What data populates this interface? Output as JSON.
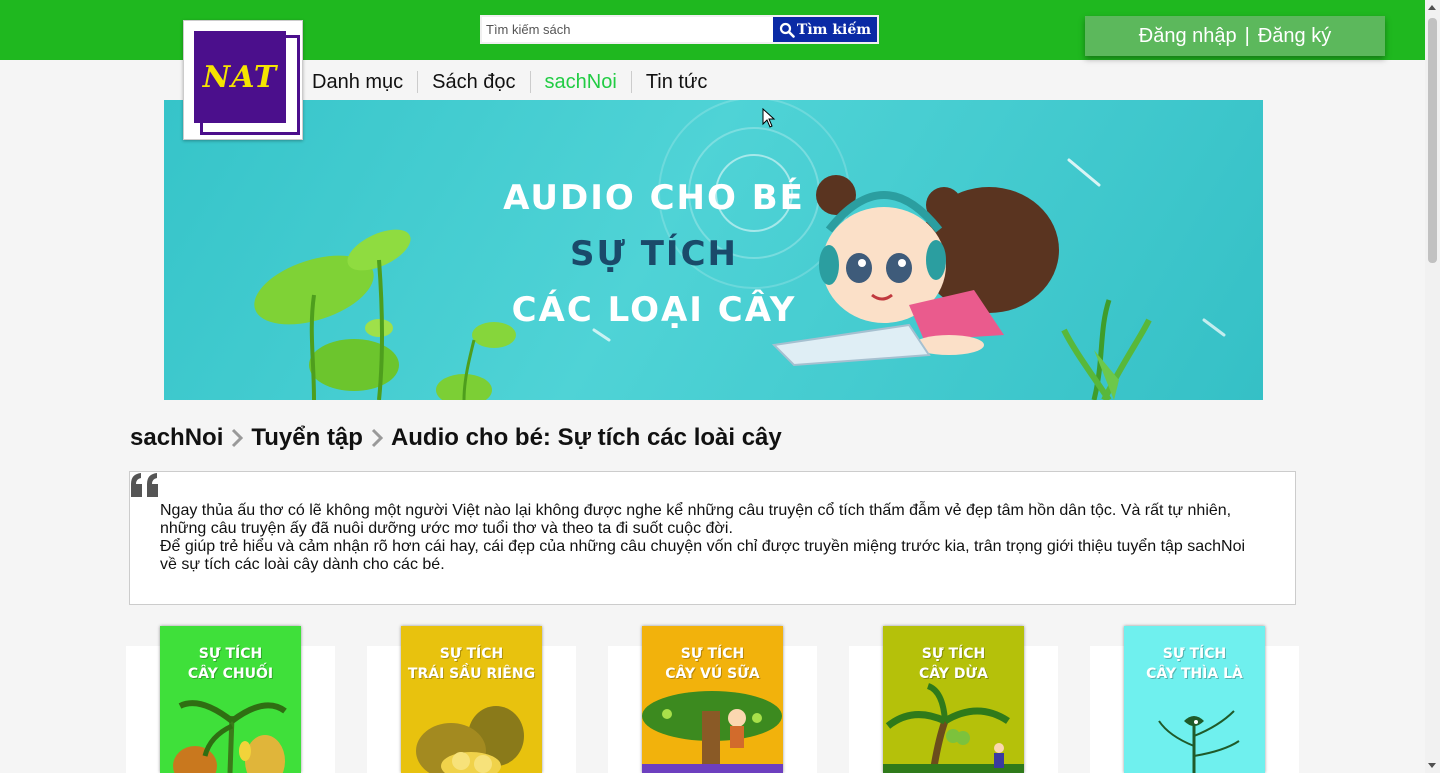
{
  "header": {
    "logo_text": "NAT",
    "search": {
      "placeholder": "Tìm kiếm sách",
      "button_label": "Tìm kiếm"
    },
    "auth": {
      "login_label": "Đăng nhập",
      "register_label": "Đăng ký"
    }
  },
  "nav": {
    "items": [
      {
        "label": "Danh mục",
        "active": false
      },
      {
        "label": "Sách đọc",
        "active": false
      },
      {
        "label": "sachNoi",
        "active": true
      },
      {
        "label": "Tin tức",
        "active": false
      }
    ]
  },
  "banner": {
    "line1": "AUDIO CHO BÉ",
    "line2": "SỰ TÍCH",
    "line3": "CÁC LOẠI CÂY"
  },
  "breadcrumb": {
    "items": [
      "sachNoi",
      "Tuyển tập",
      "Audio cho bé: Sự tích các loài cây"
    ]
  },
  "intro": {
    "paragraph1": "Ngay thủa ấu thơ có lẽ không một người Việt nào lại không được nghe kể những câu truyện cổ tích thấm đẫm vẻ đẹp tâm hồn dân tộc. Và rất tự nhiên, những câu truyện ấy đã nuôi dưỡng ước mơ tuổi thơ và theo ta đi suốt cuộc đời.",
    "paragraph2": "Để giúp trẻ hiểu và cảm nhận rõ hơn cái hay, cái đẹp của những câu chuyện vốn chỉ được truyền miệng trước kia, trân trọng giới thiệu tuyển tập sachNoi về sự tích các loài cây dành cho các bé."
  },
  "books": [
    {
      "title_line1": "SỰ TÍCH",
      "title_line2": "CÂY CHUỐI",
      "color": "#3fe03a"
    },
    {
      "title_line1": "SỰ TÍCH",
      "title_line2": "TRÁI SẦU RIÊNG",
      "color": "#e8c20e"
    },
    {
      "title_line1": "SỰ TÍCH",
      "title_line2": "CÂY VÚ SỮA",
      "color": "#f2b20c"
    },
    {
      "title_line1": "SỰ TÍCH",
      "title_line2": "CÂY DỪA",
      "color": "#b5c10a"
    },
    {
      "title_line1": "SỰ TÍCH",
      "title_line2": "CÂY THÌA LÀ",
      "color": "#6ff0ee"
    }
  ],
  "colors": {
    "header_green": "#1fb81f",
    "auth_button": "#5cb85c",
    "search_button": "#0a2aa5",
    "nav_active": "#22cc44"
  }
}
